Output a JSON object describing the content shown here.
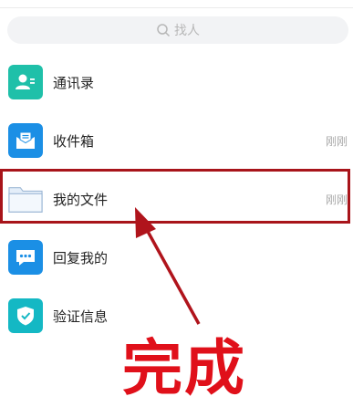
{
  "search": {
    "placeholder": "找人",
    "icon": "search-icon"
  },
  "items": [
    {
      "label": "通讯录",
      "time": "",
      "icon": "contacts-icon",
      "color": "#1fc0a9"
    },
    {
      "label": "收件箱",
      "time": "刚刚",
      "icon": "inbox-icon",
      "color": "#1b8fe5"
    },
    {
      "label": "我的文件",
      "time": "刚刚",
      "icon": "folder-icon",
      "color": "#dbe8f6"
    },
    {
      "label": "回复我的",
      "time": "",
      "icon": "chat-icon",
      "color": "#1b8fe5"
    },
    {
      "label": "验证信息",
      "time": "",
      "icon": "shield-icon",
      "color": "#14b8c4"
    }
  ],
  "annotation": {
    "text": "完成",
    "color": "#e0101a",
    "border_color": "#a8141a"
  }
}
